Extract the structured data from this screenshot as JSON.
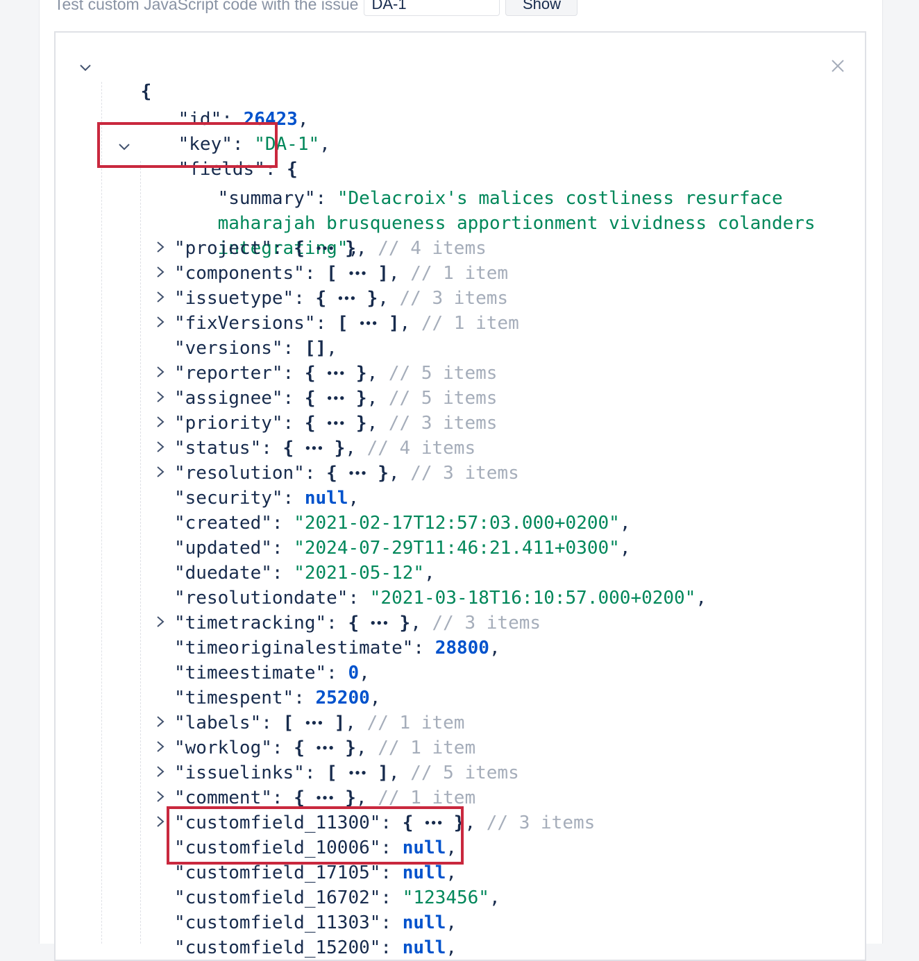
{
  "toolbar": {
    "label": "Test custom JavaScript code with the issue",
    "issue_key_value": "DA-1",
    "show_label": "Show"
  },
  "json": {
    "open_brace": "{",
    "id": {
      "key": "\"id\"",
      "value": "26423"
    },
    "key": {
      "key": "\"key\"",
      "value": "\"DA-1\""
    },
    "fields": {
      "key": "\"fields\"",
      "open": "{"
    },
    "summary": {
      "key": "\"summary\"",
      "line1": "\"Delacroix's malices costliness resurface",
      "line2": "maharajah brusqueness apportionment vividness colanders",
      "line3": "integrating\""
    },
    "entries": [
      {
        "key": "\"project\"",
        "bracket": "{",
        "close": "}",
        "comment": "// 4 items"
      },
      {
        "key": "\"components\"",
        "bracket": "[",
        "close": "]",
        "comment": "// 1 item"
      },
      {
        "key": "\"issuetype\"",
        "bracket": "{",
        "close": "}",
        "comment": "// 3 items"
      },
      {
        "key": "\"fixVersions\"",
        "bracket": "[",
        "close": "]",
        "comment": "// 1 item"
      },
      {
        "key": "\"versions\"",
        "value": "[]"
      },
      {
        "key": "\"reporter\"",
        "bracket": "{",
        "close": "}",
        "comment": "// 5 items"
      },
      {
        "key": "\"assignee\"",
        "bracket": "{",
        "close": "}",
        "comment": "// 5 items"
      },
      {
        "key": "\"priority\"",
        "bracket": "{",
        "close": "}",
        "comment": "// 3 items"
      },
      {
        "key": "\"status\"",
        "bracket": "{",
        "close": "}",
        "comment": "// 4 items"
      },
      {
        "key": "\"resolution\"",
        "bracket": "{",
        "close": "}",
        "comment": "// 3 items"
      },
      {
        "key": "\"security\"",
        "value": "null"
      },
      {
        "key": "\"created\"",
        "value": "\"2021-02-17T12:57:03.000+0200\""
      },
      {
        "key": "\"updated\"",
        "value": "\"2024-07-29T11:46:21.411+0300\""
      },
      {
        "key": "\"duedate\"",
        "value": "\"2021-05-12\""
      },
      {
        "key": "\"resolutiondate\"",
        "value": "\"2021-03-18T16:10:57.000+0200\""
      },
      {
        "key": "\"timetracking\"",
        "bracket": "{",
        "close": "}",
        "comment": "// 3 items"
      },
      {
        "key": "\"timeoriginalestimate\"",
        "value": "28800"
      },
      {
        "key": "\"timeestimate\"",
        "value": "0"
      },
      {
        "key": "\"timespent\"",
        "value": "25200"
      },
      {
        "key": "\"labels\"",
        "bracket": "[",
        "close": "]",
        "comment": "// 1 item"
      },
      {
        "key": "\"worklog\"",
        "bracket": "{",
        "close": "}",
        "comment": "// 1 item"
      },
      {
        "key": "\"issuelinks\"",
        "bracket": "[",
        "close": "]",
        "comment": "// 5 items"
      },
      {
        "key": "\"comment\"",
        "bracket": "{",
        "close": "}",
        "comment": "// 1 item"
      },
      {
        "key": "\"customfield_11300\"",
        "bracket": "{",
        "close": "}",
        "comment": "// 3 items"
      },
      {
        "key": "\"customfield_10006\"",
        "value": "null"
      },
      {
        "key": "\"customfield_17105\"",
        "value": "null"
      },
      {
        "key": "\"customfield_16702\"",
        "value": "\"123456\""
      },
      {
        "key": "\"customfield_11303\"",
        "value": "null"
      },
      {
        "key": "\"customfield_15200\"",
        "value": "null"
      }
    ]
  }
}
